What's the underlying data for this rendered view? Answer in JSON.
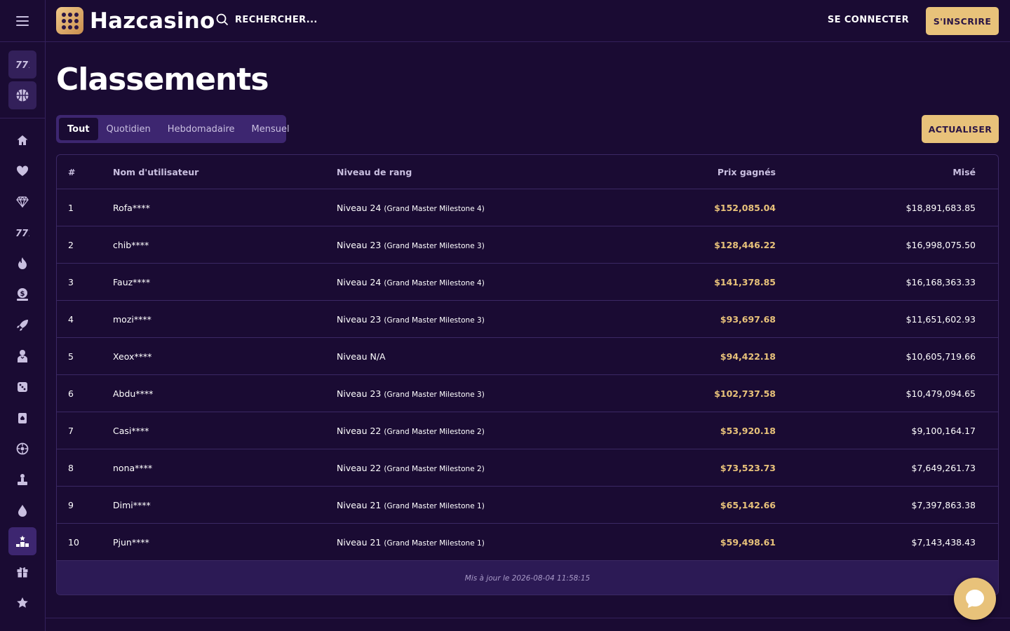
{
  "header": {
    "brand": "Hazcasino",
    "search_label": "RECHERCHER...",
    "login_label": "SE CONNECTER",
    "signup_label": "S'INSCRIRE"
  },
  "sidebar": {
    "top_categories": [
      "slots-icon",
      "sports-icon"
    ],
    "items": [
      {
        "icon": "home-icon"
      },
      {
        "icon": "heart-icon"
      },
      {
        "icon": "diamond-icon"
      },
      {
        "icon": "slots-icon"
      },
      {
        "icon": "flame-icon"
      },
      {
        "icon": "money-bag-icon"
      },
      {
        "icon": "rocket-icon"
      },
      {
        "icon": "dealer-icon"
      },
      {
        "icon": "dice-icon"
      },
      {
        "icon": "cards-icon"
      },
      {
        "icon": "roulette-icon"
      },
      {
        "icon": "podium-figure-icon"
      },
      {
        "icon": "drop-icon"
      },
      {
        "icon": "leaderboard-icon",
        "active": true
      },
      {
        "icon": "gift-icon"
      },
      {
        "icon": "star-icon"
      }
    ]
  },
  "page": {
    "title": "Classements",
    "tabs": [
      "Tout",
      "Quotidien",
      "Hebdomadaire",
      "Mensuel"
    ],
    "active_tab": "Tout",
    "refresh_label": "ACTUALISER"
  },
  "table": {
    "headers": {
      "rank": "#",
      "user": "Nom d'utilisateur",
      "level": "Niveau de rang",
      "prize": "Prix gagnés",
      "bet": "Misé"
    },
    "rows": [
      {
        "rank": "1",
        "user": "Rofa****",
        "level": "Niveau 24",
        "milestone": "(Grand Master Milestone 4)",
        "prize": "$152,085.04",
        "bet": "$18,891,683.85"
      },
      {
        "rank": "2",
        "user": "chib****",
        "level": "Niveau 23",
        "milestone": "(Grand Master Milestone 3)",
        "prize": "$128,446.22",
        "bet": "$16,998,075.50"
      },
      {
        "rank": "3",
        "user": "Fauz****",
        "level": "Niveau 24",
        "milestone": "(Grand Master Milestone 4)",
        "prize": "$141,378.85",
        "bet": "$16,168,363.33"
      },
      {
        "rank": "4",
        "user": "mozi****",
        "level": "Niveau 23",
        "milestone": "(Grand Master Milestone 3)",
        "prize": "$93,697.68",
        "bet": "$11,651,602.93"
      },
      {
        "rank": "5",
        "user": "Xeox****",
        "level": "Niveau N/A",
        "milestone": "",
        "prize": "$94,422.18",
        "bet": "$10,605,719.66"
      },
      {
        "rank": "6",
        "user": "Abdu****",
        "level": "Niveau 23",
        "milestone": "(Grand Master Milestone 3)",
        "prize": "$102,737.58",
        "bet": "$10,479,094.65"
      },
      {
        "rank": "7",
        "user": "Casi****",
        "level": "Niveau 22",
        "milestone": "(Grand Master Milestone 2)",
        "prize": "$53,920.18",
        "bet": "$9,100,164.17"
      },
      {
        "rank": "8",
        "user": "nona****",
        "level": "Niveau 22",
        "milestone": "(Grand Master Milestone 2)",
        "prize": "$73,523.73",
        "bet": "$7,649,261.73"
      },
      {
        "rank": "9",
        "user": "Dimi****",
        "level": "Niveau 21",
        "milestone": "(Grand Master Milestone 1)",
        "prize": "$65,142.66",
        "bet": "$7,397,863.38"
      },
      {
        "rank": "10",
        "user": "Pjun****",
        "level": "Niveau 21",
        "milestone": "(Grand Master Milestone 1)",
        "prize": "$59,498.61",
        "bet": "$7,143,438.43"
      }
    ],
    "footer": "Mis à jour le 2026-08-04 11:58:15"
  },
  "colors": {
    "background": "#1a0b33",
    "accent": "#e8c27a",
    "tab_bar": "#3d2670",
    "footer": "#2c1a55"
  }
}
